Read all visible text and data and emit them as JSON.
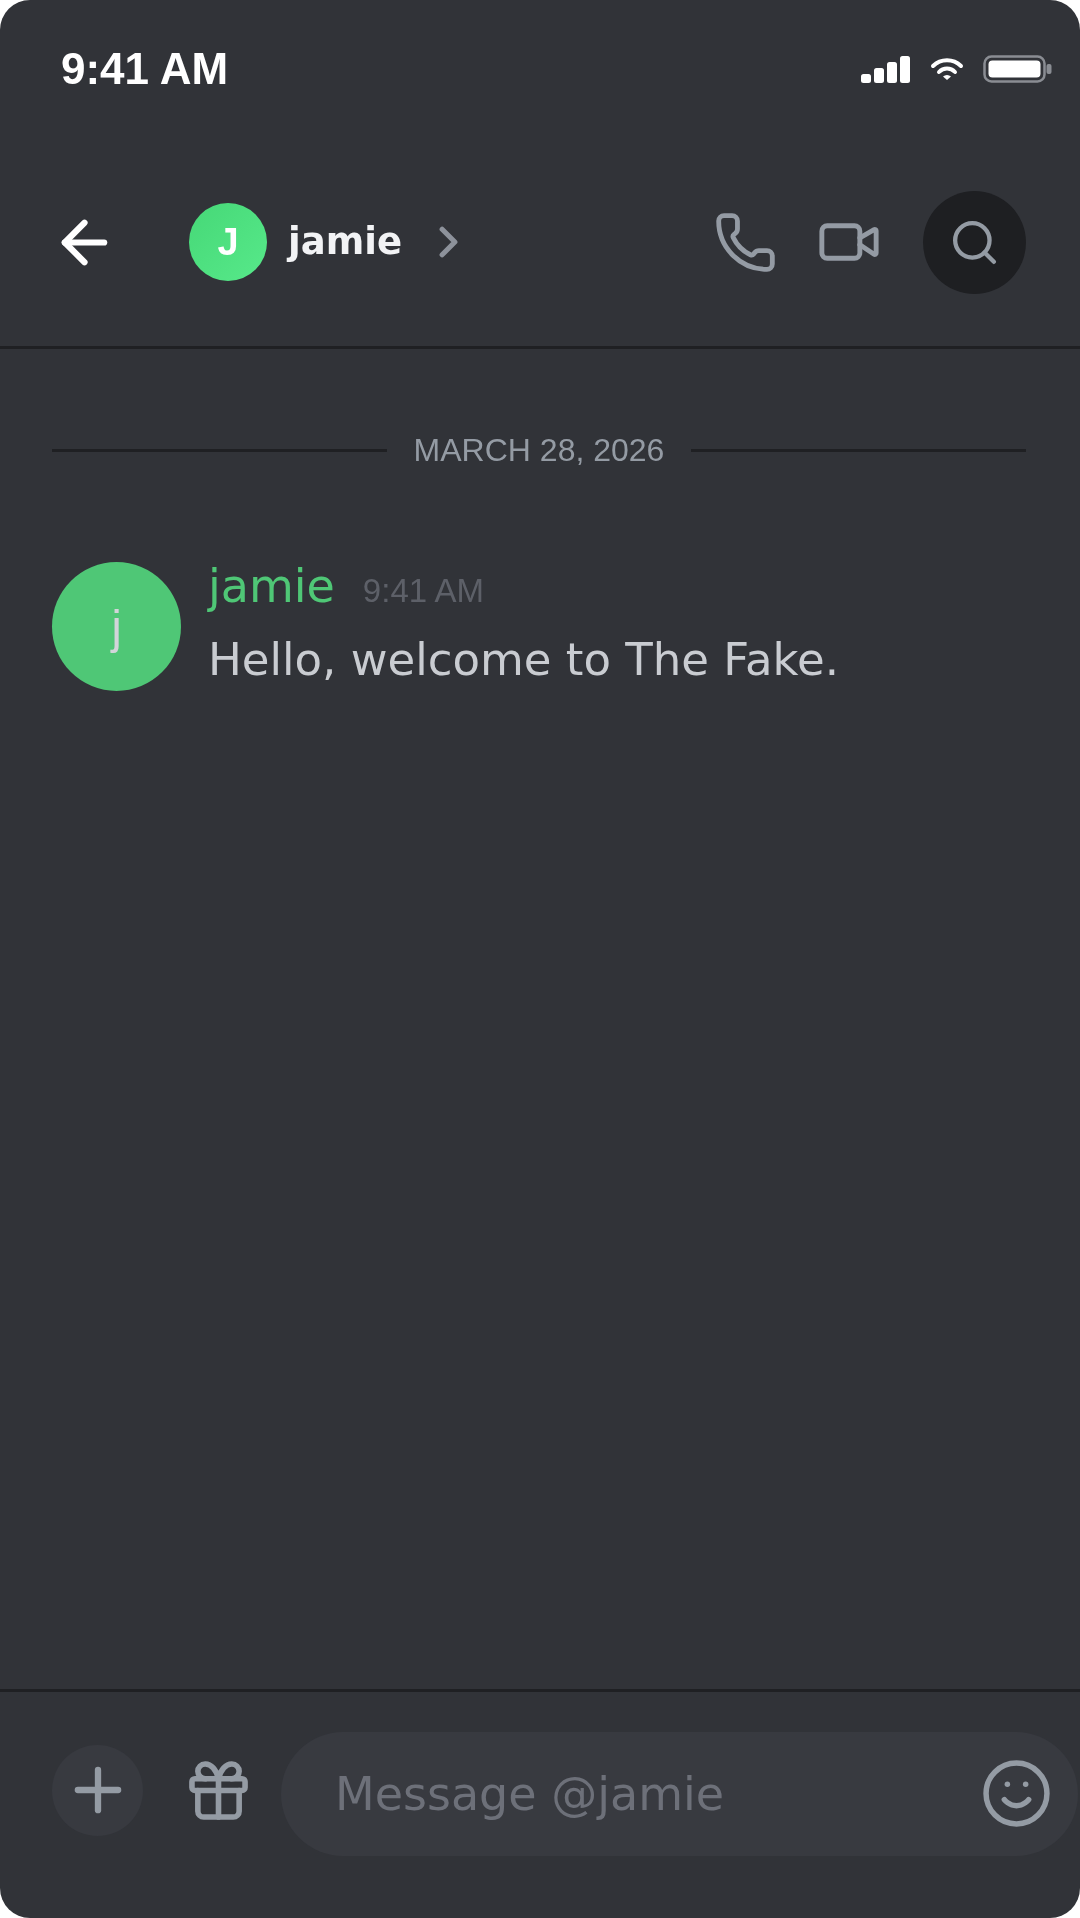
{
  "status_bar": {
    "time": "9:41 AM"
  },
  "header": {
    "avatar_letter": "J",
    "title": "jamie"
  },
  "date_divider": {
    "label": "MARCH 28, 2026"
  },
  "messages": [
    {
      "avatar_letter": "j",
      "author": "jamie",
      "time": "9:41 AM",
      "text": "Hello, welcome to The Fake."
    }
  ],
  "composer": {
    "placeholder": "Message @jamie"
  }
}
